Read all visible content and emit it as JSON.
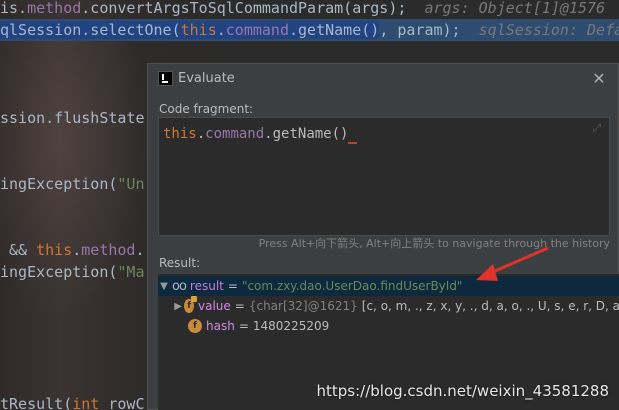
{
  "editor": {
    "line1": {
      "pre": "is.",
      "field": "method",
      "mid": ".convertArgsToSqlCommandParam(args);",
      "hint": "args: Object[1]@1576"
    },
    "line2": {
      "pre": "qlSession.selectOne(",
      "kw": "this",
      "dot": ".",
      "field": "command",
      "call": ".getName()",
      "post": ", param);",
      "hint": "sqlSession: Defa"
    },
    "line3": "ssion.flushState",
    "line4": {
      "pre": "ingException(",
      "str": "\"Un"
    },
    "line5": {
      "pre": " && ",
      "kw": "this",
      "dot": ".",
      "field": "method",
      "post": "."
    },
    "line6": {
      "pre": "ingException(",
      "str": "\"Ma"
    },
    "line7": {
      "pre": "tResult(",
      "kw": "int",
      "post": " rowC"
    }
  },
  "dialog": {
    "title": "Evaluate",
    "close_symbol": "✕",
    "code_fragment_label": "Code fragment:",
    "code": {
      "kw": "this",
      "dot": ".",
      "field": "command",
      "call": ".getName()"
    },
    "shortcut_hint": "Press Alt+向下箭头, Alt+向上箭头 to navigate through the history",
    "result_label": "Result:",
    "result": {
      "root": {
        "name": "result",
        "eq": "=",
        "value": "\"com.zxy.dao.UserDao.findUserById\""
      },
      "children": [
        {
          "icon": "f",
          "name": "value",
          "eq": "=",
          "type": "{char[32]@1621}",
          "value": "[c, o, m, ., z, x, y, ., d, a, o, ., U, s, e, r, D, a"
        },
        {
          "icon": "f",
          "name": "hash",
          "eq": "=",
          "value": "1480225209"
        }
      ]
    }
  },
  "watermark": "https://blog.csdn.net/weixin_43581288",
  "colors": {
    "keyword": "#cc7832",
    "field": "#9876aa",
    "string": "#6a8759",
    "annotation_arrow": "#e0312b",
    "selection": "#0d293e"
  }
}
